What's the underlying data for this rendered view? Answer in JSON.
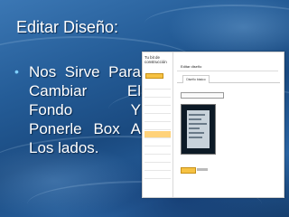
{
  "slide": {
    "title": "Editar Diseño:",
    "bullet": "Nos Sirve Para Cambiar El Fondo Y Ponerle Box A Los lados."
  },
  "screenshot": {
    "sidebar": {
      "header": "Tu bit de construcción",
      "button_label": "",
      "items": [
        "",
        "",
        "",
        "",
        "",
        "",
        "",
        "",
        "",
        "",
        "",
        ""
      ],
      "active_index": 6
    },
    "main": {
      "heading": "Editar diseño",
      "tab_label": "Diseño básico",
      "select_label": "",
      "select_value": "",
      "save_label": ""
    }
  },
  "colors": {
    "title_text": "#ffffff",
    "bullet_marker": "#7fd0ff",
    "accent_button": "#f6c243",
    "active_item": "#ffd27a"
  }
}
